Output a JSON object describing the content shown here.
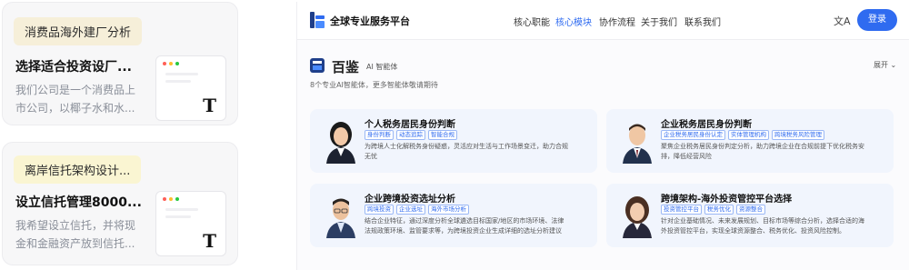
{
  "left": {
    "card1": {
      "tag": "消费品海外建厂分析",
      "title": "选择适合投资设厂...",
      "desc_line1": "我们公司是一个消费品上",
      "desc_line2": "市公司，以椰子水和水...",
      "thumb_letter": "T"
    },
    "card2": {
      "tag": "离岸信托架构设计...",
      "title": "设立信托管理8000...",
      "desc_line1": "我希望设立信托，并将现",
      "desc_line2": "金和金融资产放到信托...",
      "thumb_letter": "T"
    }
  },
  "header": {
    "brand": "全球专业服务平台",
    "nav": [
      "核心职能",
      "核心模块",
      "协作流程",
      "关于我们",
      "联系我们"
    ],
    "active_nav": "核心模块",
    "lang_icon": "文A",
    "login": "登录"
  },
  "section": {
    "name": "百鉴",
    "sub": "AI 智能体",
    "expand": "展开 ⌄",
    "subtitle": "8个专业AI智能体，更多智能体敬请期待"
  },
  "agents": [
    {
      "title": "个人税务居民身份判断",
      "chips": [
        "身份判断",
        "动态追踪",
        "智能合规"
      ],
      "desc_line1": "为跨境人士化解税务身份疑惑，灵活应对生活与工作场景变迁，助力合规",
      "desc_line2": "无忧"
    },
    {
      "title": "企业税务居民身份判断",
      "chips": [
        "企业税务居民身份认定",
        "实体管理机构",
        "跨境税务风险管理"
      ],
      "desc_line1": "聚焦企业税务居民身份判定分析，助力跨境企业在合规前提下优化税务安",
      "desc_line2": "排，降低经营风险"
    },
    {
      "title": "企业跨境投资选址分析",
      "chips": [
        "跨境投资",
        "企业选址",
        "海外市场分析"
      ],
      "desc_line1": "结合企业特征，通过深度分析全球遴选目标国家/地区的市场环境、法律",
      "desc_line2": "法规政策环境、监管要求等，为跨境投资企业生成详细的选址分析建议"
    },
    {
      "title": "跨境架构-海外投资管控平台选择",
      "chips": [
        "投资管控平台",
        "税务优化",
        "资源整合"
      ],
      "desc_line1": "针对企业基础情况、未来发展规划、目标市场等综合分析，选择合适的海",
      "desc_line2": "外投资管控平台，实现全球资源整合、税务优化、投资风险控制。"
    }
  ],
  "colors": {
    "accent": "#2f6bf0",
    "card_bg": "#f1f5fd"
  }
}
